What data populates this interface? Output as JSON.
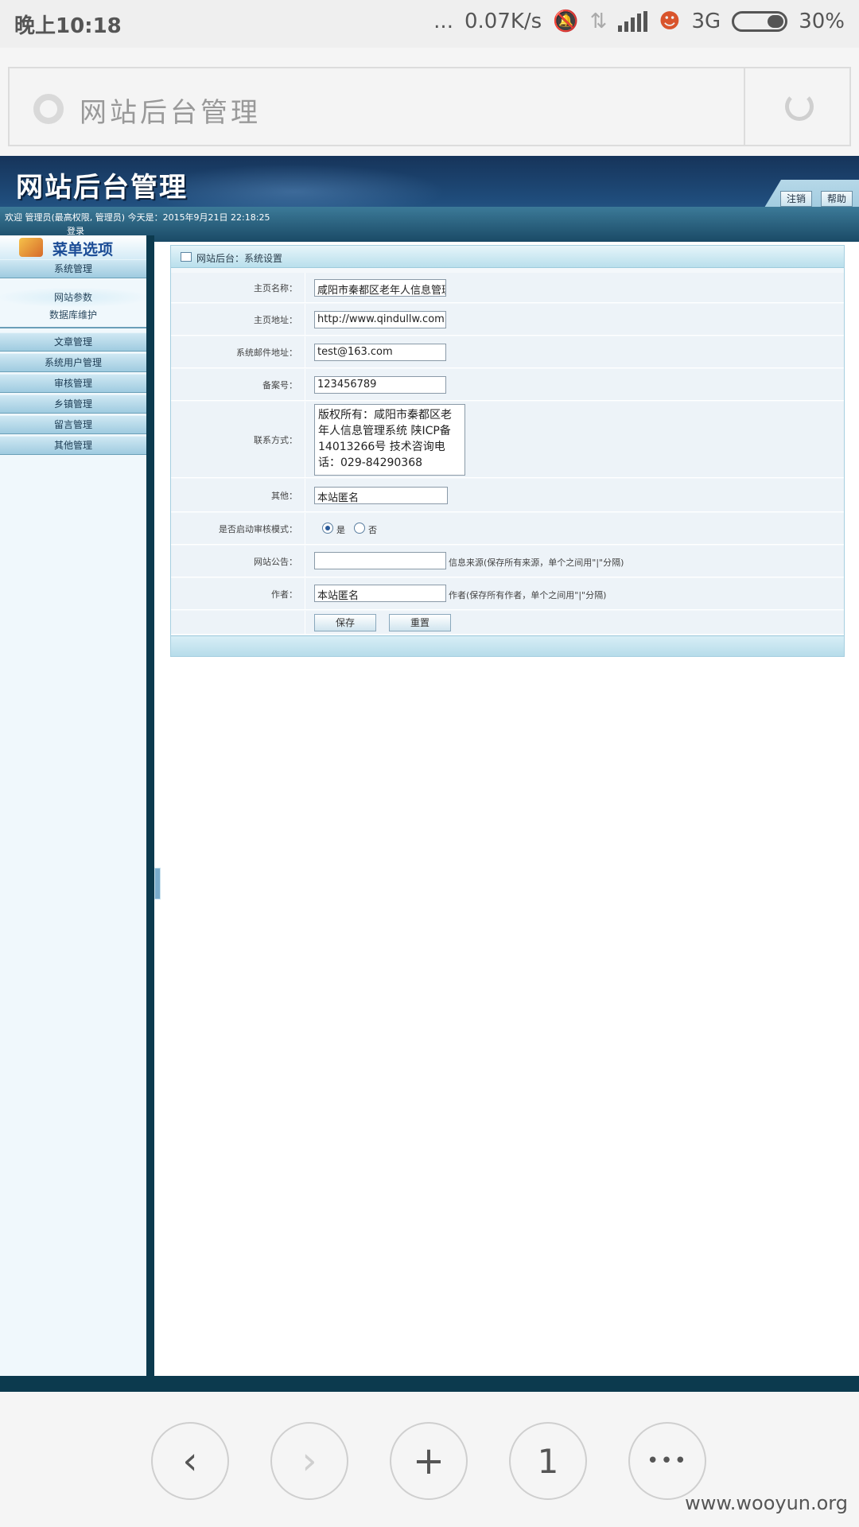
{
  "status_bar": {
    "time": "晚上10:18",
    "speed": "0.07K/s",
    "network": "3G",
    "battery": "30%",
    "dots": "..."
  },
  "address_bar": {
    "title": "网站后台管理"
  },
  "site": {
    "banner_title": "网站后台管理",
    "logout_label": "注销",
    "help_label": "帮助",
    "welcome_text": "欢迎 管理员(最高权限, 管理员) 今天是：2015年9月21日 22:18:25",
    "login_text": "登录"
  },
  "sidebar": {
    "menu_title": "菜单选项",
    "categories": [
      {
        "label": "系统管理",
        "subitems": [
          "网站参数",
          "数据库维护"
        ]
      },
      {
        "label": "文章管理"
      },
      {
        "label": "系统用户管理"
      },
      {
        "label": "审核管理"
      },
      {
        "label": "乡镇管理"
      },
      {
        "label": "留言管理"
      },
      {
        "label": "其他管理"
      }
    ]
  },
  "panel": {
    "breadcrumb": "网站后台：系统设置",
    "fields": {
      "homepage_name": {
        "label": "主页名称：",
        "value": "咸阳市秦都区老年人信息管理系统"
      },
      "homepage_url": {
        "label": "主页地址：",
        "value": "http://www.qindullw.com"
      },
      "email": {
        "label": "系统邮件地址：",
        "value": "test@163.com"
      },
      "icp": {
        "label": "备案号：",
        "value": "123456789"
      },
      "contact": {
        "label": "联系方式：",
        "value": "版权所有：咸阳市秦都区老年人信息管理系统 陕ICP备14013266号 技术咨询电话：029-84290368"
      },
      "other": {
        "label": "其他：",
        "value": "本站匿名"
      },
      "audit": {
        "label": "是否启动审核模式：",
        "yes": "是",
        "no": "否",
        "selected": "yes"
      },
      "notice": {
        "label": "网站公告：",
        "value": "",
        "note": "信息来源(保存所有来源，单个之间用\"|\"分隔)"
      },
      "author": {
        "label": "作者：",
        "value": "本站匿名",
        "note": "作者(保存所有作者，单个之间用\"|\"分隔)"
      }
    },
    "save_label": "保存",
    "reset_label": "重置"
  },
  "bottom_nav": {
    "back": "‹",
    "forward": "›",
    "new_tab": "+",
    "tabs_count": "1",
    "more": "•••",
    "watermark": "www.wooyun.org"
  }
}
